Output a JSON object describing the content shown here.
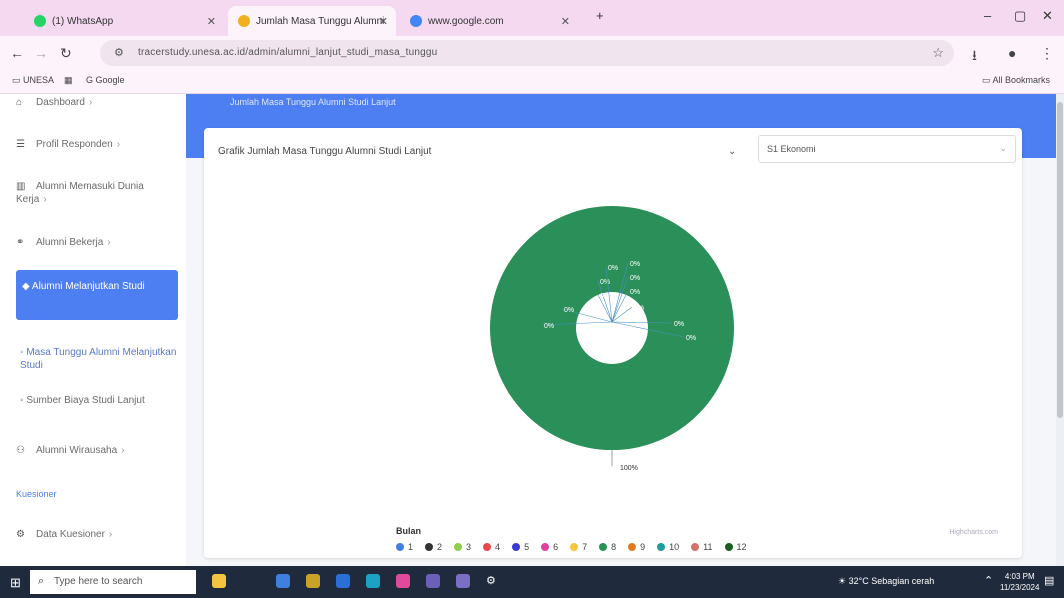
{
  "browser": {
    "tabs": [
      {
        "label": "(1) WhatsApp",
        "favicon_color": "#25d366"
      },
      {
        "label": "Jumlah Masa Tunggu Alumni",
        "favicon_color": "#f2b01e"
      },
      {
        "label": "www.google.com",
        "favicon_color": "#4285f4"
      }
    ],
    "new_tab": "+",
    "url": "tracerstudy.unesa.ac.id/admin/alumni_lanjut_studi_masa_tunggu",
    "bookmarks": {
      "unesa": "UNESA",
      "google": "Google",
      "all": "All Bookmarks"
    }
  },
  "sidebar": {
    "items": [
      {
        "label": "Dashboard",
        "icon": "home-icon"
      },
      {
        "label": "Profil Responden",
        "icon": "chart-icon"
      },
      {
        "label": "Alumni Memasuki Dunia Kerja",
        "icon": "building-icon"
      },
      {
        "label": "Alumni Bekerja",
        "icon": "binoculars-icon"
      }
    ],
    "active_item": {
      "label": "Alumni Melanjutkan Studi",
      "icon": "graduation-cap-icon"
    },
    "sub_items": [
      {
        "label": "Masa Tunggu Alumni Melanjutkan Studi"
      },
      {
        "label": "Sumber Biaya Studi Lanjut"
      }
    ],
    "wirausaha": {
      "label": "Alumni Wirausaha",
      "icon": "handshake-icon"
    },
    "section_label": "Kuesioner",
    "kuesioner_item": {
      "label": "Data Kuesioner",
      "icon": "gear-icon"
    }
  },
  "content": {
    "banner_title": "Jumlah Masa Tunggu Alumni Studi Lanjut",
    "card_title": "Grafik Jumlah Masa Tunggu Alumni Studi Lanjut",
    "select_value": "S1 Ekonomi",
    "credit": "Highcharts.com"
  },
  "chart_data": {
    "type": "pie",
    "inner_hole": true,
    "legend_title": "Bulan",
    "legend_placement": "bottom",
    "categories": [
      "1",
      "2",
      "3",
      "4",
      "5",
      "6",
      "7",
      "8",
      "9",
      "10",
      "11",
      "12"
    ],
    "colors": [
      "#3f7fe0",
      "#333333",
      "#8ccf4d",
      "#e8484b",
      "#3a3ad6",
      "#e040a0",
      "#f5c542",
      "#2b8f5a",
      "#e07b22",
      "#1a9ea0",
      "#d4716b",
      "#1b5e20"
    ],
    "values": [
      0,
      0,
      0,
      0,
      0,
      0,
      0,
      100,
      0,
      0,
      0,
      0
    ],
    "data_labels": [
      "0%",
      "0%",
      "0%",
      "0%",
      "0%",
      "0%",
      "0%",
      "100%",
      "0%",
      "0%",
      "0%",
      "0%"
    ]
  },
  "taskbar": {
    "search_placeholder": "Type here to search",
    "weather": "32°C  Sebagian cerah",
    "time": "4:03 PM",
    "date": "11/23/2024"
  }
}
